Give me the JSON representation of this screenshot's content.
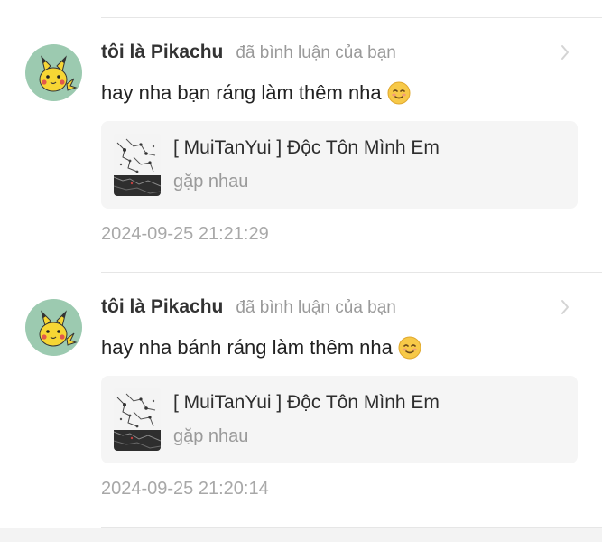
{
  "notifications": [
    {
      "username": "tôi là Pikachu",
      "action": "đã bình luận của bạn",
      "comment": "hay nha bạn ráng làm thêm nha",
      "emoji_icon": "smiling-face-icon",
      "song": {
        "title": "[ MuiTanYui ] Độc Tôn Mình Em",
        "subtitle": "gặp nhau"
      },
      "timestamp": "2024-09-25 21:21:29"
    },
    {
      "username": "tôi là Pikachu",
      "action": "đã bình luận của bạn",
      "comment": "hay nha bánh ráng làm thêm nha",
      "emoji_icon": "smiling-face-icon",
      "song": {
        "title": "[ MuiTanYui ] Độc Tôn Mình Em",
        "subtitle": "gặp nhau"
      },
      "timestamp": "2024-09-25 21:20:14"
    }
  ],
  "colors": {
    "avatar_bg": "#9ccab0",
    "card_bg": "#f5f5f5",
    "divider": "#e6e6e6",
    "muted_text": "#9a9a9a"
  }
}
